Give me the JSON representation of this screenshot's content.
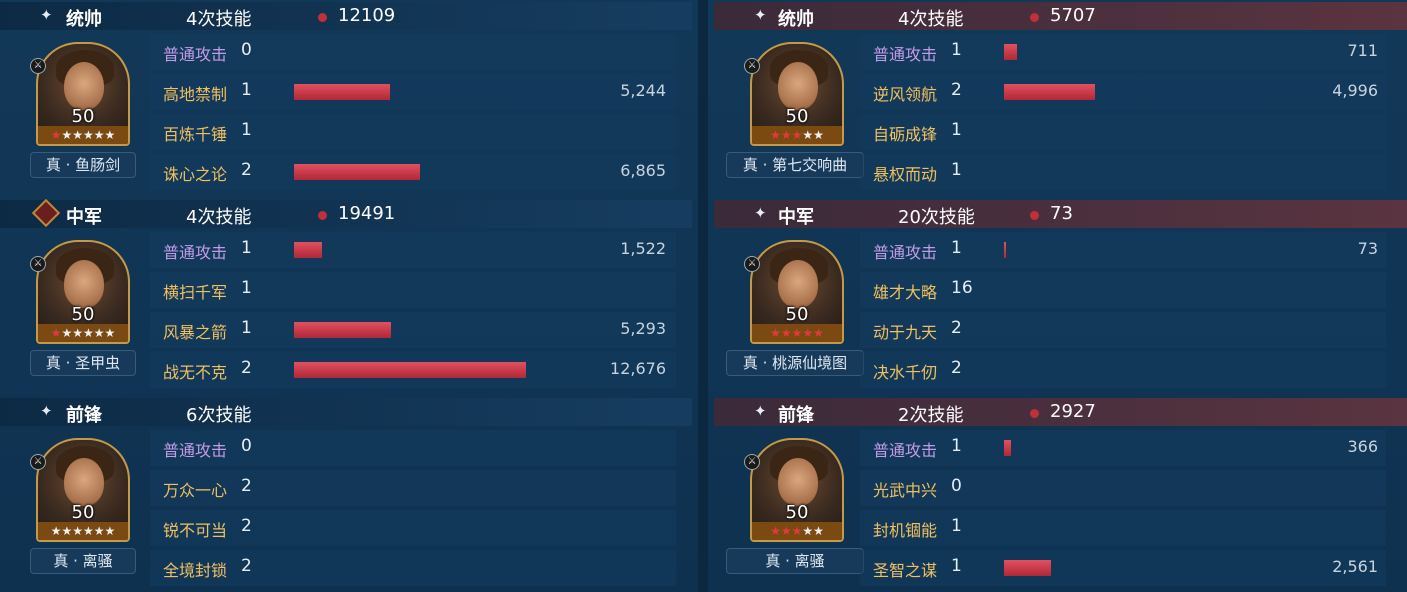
{
  "left": [
    {
      "role": "统帅",
      "skills": "4次技能",
      "total": "12109",
      "level": "50",
      "weapon": "真 · 鱼肠剑",
      "red_stars": 1,
      "stars": 6,
      "rows": [
        {
          "name": "普通攻击",
          "count": "0",
          "damage": "",
          "bar": 0
        },
        {
          "name": "高地禁制",
          "count": "1",
          "damage": "5,244",
          "bar": 5244
        },
        {
          "name": "百炼千锤",
          "count": "1",
          "damage": "",
          "bar": 0
        },
        {
          "name": "诛心之论",
          "count": "2",
          "damage": "6,865",
          "bar": 6865
        }
      ]
    },
    {
      "role": "中军",
      "skills": "4次技能",
      "total": "19491",
      "level": "50",
      "weapon": "真 · 圣甲虫",
      "red_stars": 1,
      "stars": 6,
      "rows": [
        {
          "name": "普通攻击",
          "count": "1",
          "damage": "1,522",
          "bar": 1522
        },
        {
          "name": "横扫千军",
          "count": "1",
          "damage": "",
          "bar": 0
        },
        {
          "name": "风暴之箭",
          "count": "1",
          "damage": "5,293",
          "bar": 5293
        },
        {
          "name": "战无不克",
          "count": "2",
          "damage": "12,676",
          "bar": 12676
        }
      ]
    },
    {
      "role": "前锋",
      "skills": "6次技能",
      "total": "",
      "level": "50",
      "weapon": "真 · 离骚",
      "red_stars": 0,
      "stars": 6,
      "rows": [
        {
          "name": "普通攻击",
          "count": "0",
          "damage": "",
          "bar": 0
        },
        {
          "name": "万众一心",
          "count": "2",
          "damage": "",
          "bar": 0
        },
        {
          "name": "锐不可当",
          "count": "2",
          "damage": "",
          "bar": 0
        },
        {
          "name": "全境封锁",
          "count": "2",
          "damage": "",
          "bar": 0
        }
      ]
    }
  ],
  "right": [
    {
      "role": "统帅",
      "skills": "4次技能",
      "total": "5707",
      "level": "50",
      "weapon": "真 · 第七交响曲",
      "red_stars": 3,
      "stars": 5,
      "rows": [
        {
          "name": "普通攻击",
          "count": "1",
          "damage": "711",
          "bar": 711
        },
        {
          "name": "逆风领航",
          "count": "2",
          "damage": "4,996",
          "bar": 4996
        },
        {
          "name": "自砺成锋",
          "count": "1",
          "damage": "",
          "bar": 0
        },
        {
          "name": "悬权而动",
          "count": "1",
          "damage": "",
          "bar": 0
        }
      ]
    },
    {
      "role": "中军",
      "skills": "20次技能",
      "total": "73",
      "level": "50",
      "weapon": "真 · 桃源仙境图",
      "red_stars": 5,
      "stars": 5,
      "rows": [
        {
          "name": "普通攻击",
          "count": "1",
          "damage": "73",
          "bar": 73
        },
        {
          "name": "雄才大略",
          "count": "16",
          "damage": "",
          "bar": 0
        },
        {
          "name": "动于九天",
          "count": "2",
          "damage": "",
          "bar": 0
        },
        {
          "name": "决水千仞",
          "count": "2",
          "damage": "",
          "bar": 0
        }
      ]
    },
    {
      "role": "前锋",
      "skills": "2次技能",
      "total": "2927",
      "level": "50",
      "weapon": "真 · 离骚",
      "red_stars": 3,
      "stars": 5,
      "rows": [
        {
          "name": "普通攻击",
          "count": "1",
          "damage": "366",
          "bar": 366
        },
        {
          "name": "光武中兴",
          "count": "0",
          "damage": "",
          "bar": 0
        },
        {
          "name": "封机锢能",
          "count": "1",
          "damage": "",
          "bar": 0
        },
        {
          "name": "圣智之谋",
          "count": "1",
          "damage": "2,561",
          "bar": 2561
        }
      ]
    }
  ],
  "bar_max_damage": 12676,
  "colors": {
    "bar": "#c8303e",
    "basic_attack": "#c49be8",
    "skill": "#f0c060",
    "header_left": "#163d60",
    "header_right": "#5a3440"
  }
}
